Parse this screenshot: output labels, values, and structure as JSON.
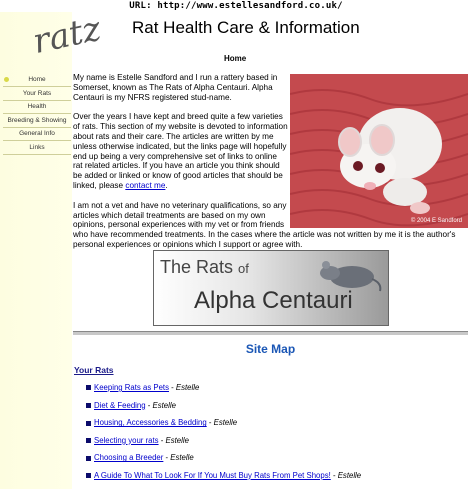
{
  "url_bar": "URL: http://www.estellesandford.co.uk/",
  "logo_text": "ratz",
  "nav": [
    {
      "label": "Home",
      "active": true
    },
    {
      "label": "Your Rats",
      "active": false
    },
    {
      "label": "Health",
      "active": false
    },
    {
      "label": "Breeding & Showing",
      "active": false
    },
    {
      "label": "General Info",
      "active": false
    },
    {
      "label": "Links",
      "active": false
    }
  ],
  "page_title": "Rat Health Care & Information",
  "section_heading": "Home",
  "photo_copyright": "© 2004 E Sandford",
  "intro": {
    "p1": "My name is Estelle Sandford and I run a rattery based in Somerset, known as The Rats of Alpha Centauri. Alpha Centauri is my NFRS registered stud-name.",
    "p2_before": "Over the years I have kept and breed quite a few varieties of rats. This section of my website is devoted to information about rats and their care. The articles are written by me unless otherwise indicated, but the links page will hopefully end up being a very comprehensive set of links to online rat related articles. If you have an article you think should be added or linked or know of good articles that should be linked, please ",
    "p2_link": "contact me",
    "p2_after": ".",
    "p3": "I am not a vet and have no veterinary qualifications, so any articles which detail treatments are based on my own opinions, personal experiences with my vet or from friends who have recommended treatments. In the cases where the article was not written by me it is the author's personal experiences or opinions which I support or agree with."
  },
  "banner": {
    "line1": "The Rats",
    "line1_of": "of",
    "line2": "Alpha Centauri"
  },
  "sitemap_title": "Site Map",
  "sitemap_section": "Your Rats",
  "sitemap_links": [
    {
      "title": "Keeping Rats as Pets",
      "sep": " - ",
      "author": "Estelle"
    },
    {
      "title": "Diet & Feeding",
      "sep": " - ",
      "author": "Estelle"
    },
    {
      "title": "Housing, Accessories & Bedding",
      "sep": " - ",
      "author": "Estelle"
    },
    {
      "title": "Selecting your rats",
      "sep": " - ",
      "author": "Estelle"
    },
    {
      "title": "Choosing a Breeder",
      "sep": " - ",
      "author": "Estelle"
    },
    {
      "title": "A Guide To What To Look For If You Must Buy Rats From Pet Shops!",
      "sep": " - ",
      "author": "Estelle"
    }
  ]
}
